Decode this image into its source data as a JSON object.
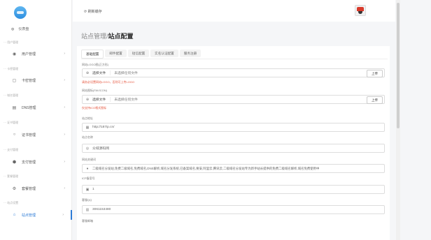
{
  "sidebar": {
    "home_label": "仪表盘",
    "groups": [
      "用户管理",
      "卡密管理",
      "域名管理",
      "证书管理",
      "支付管理",
      "套餐管理",
      "站点设置"
    ],
    "items": [
      {
        "label": "用户管理",
        "icon": "user-icon"
      },
      {
        "label": "卡密管理",
        "icon": "card-icon"
      },
      {
        "label": "DNS管理",
        "icon": "dns-icon"
      },
      {
        "label": "证书管理",
        "icon": "certificate-icon"
      },
      {
        "label": "支付管理",
        "icon": "payment-icon"
      },
      {
        "label": "套餐管理",
        "icon": "package-icon"
      },
      {
        "label": "站点管理",
        "icon": "site-icon"
      }
    ]
  },
  "topbar": {
    "refresh_label": "刷新缓存"
  },
  "breadcrumb": {
    "parent": "站点管理/",
    "current": "站点配置"
  },
  "tabs": [
    "基础配置",
    "邮件配置",
    "短信配置",
    "实名认证配置",
    "服务注册"
  ],
  "form": {
    "logo": {
      "label": "网站LOGO图(正方形)",
      "file_button": "选择文件",
      "file_name": "未选择任何文件",
      "upload": "上传",
      "hint": "请务必设置网站LOGO，否则可上传LOGO"
    },
    "icon": {
      "label": "网站图标(FAVICON)",
      "file_button": "选择文件",
      "file_name": "未选择任何文件",
      "upload": "上传",
      "hint": "仅支持ICO格式图标"
    },
    "site_url": {
      "label": "站点地址",
      "value": "http://187ip.cn/"
    },
    "site_name": {
      "label": "站点名称",
      "value": "众域源码网"
    },
    "keywords": {
      "label": "网站关键词",
      "value": "二级域名分发站,免费二级域名,免费域名,DNS解析,域名分发系统,已备案域名,要安,阿里云,腾讯云,二级域名分发站专为新手站长提供的免费二级域名解析,域名免费使用中"
    },
    "icp": {
      "label": "ICP备案号",
      "value": "1"
    },
    "qq": {
      "label": "客服QQ",
      "value": "3061153480"
    },
    "email": {
      "label": "客服邮箱"
    }
  }
}
